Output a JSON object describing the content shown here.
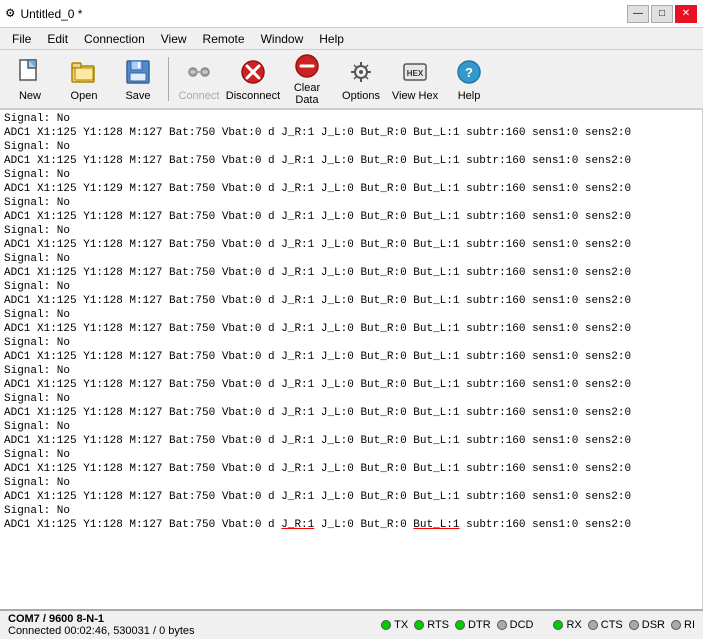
{
  "titlebar": {
    "icon": "⚙",
    "title": "Untitled_0 *",
    "minimize": "—",
    "maximize": "□",
    "close": "✕"
  },
  "menubar": {
    "items": [
      "File",
      "Edit",
      "Connection",
      "View",
      "Remote",
      "Window",
      "Help"
    ]
  },
  "toolbar": {
    "buttons": [
      {
        "id": "new",
        "label": "New",
        "icon": "new",
        "disabled": false
      },
      {
        "id": "open",
        "label": "Open",
        "icon": "open",
        "disabled": false
      },
      {
        "id": "save",
        "label": "Save",
        "icon": "save",
        "disabled": false
      },
      {
        "id": "connect",
        "label": "Connect",
        "icon": "connect",
        "disabled": true
      },
      {
        "id": "disconnect",
        "label": "Disconnect",
        "icon": "disconnect",
        "disabled": false
      },
      {
        "id": "clear",
        "label": "Clear Data",
        "icon": "clear",
        "disabled": false
      },
      {
        "id": "options",
        "label": "Options",
        "icon": "options",
        "disabled": false
      },
      {
        "id": "viewhex",
        "label": "View Hex",
        "icon": "viewhex",
        "disabled": false
      },
      {
        "id": "help",
        "label": "Help",
        "icon": "help",
        "disabled": false
      }
    ]
  },
  "log": {
    "lines": [
      "Signal: No",
      "ADC1 X1:125 Y1:128  M:127 Bat:750 Vbat:0 d J_R:1 J_L:0 But_R:0 But_L:1 subtr:160 sens1:0 sens2:0",
      "Signal: No",
      "ADC1 X1:125 Y1:128  M:127 Bat:750 Vbat:0 d J_R:1 J_L:0 But_R:0 But_L:1 subtr:160 sens1:0 sens2:0",
      "Signal: No",
      "ADC1 X1:125 Y1:129  M:127 Bat:750 Vbat:0 d J_R:1 J_L:0 But_R:0 But_L:1 subtr:160 sens1:0 sens2:0",
      "Signal: No",
      "ADC1 X1:125 Y1:128  M:127 Bat:750 Vbat:0 d J_R:1 J_L:0 But_R:0 But_L:1 subtr:160 sens1:0 sens2:0",
      "Signal: No",
      "ADC1 X1:125 Y1:128  M:127 Bat:750 Vbat:0 d J_R:1 J_L:0 But_R:0 But_L:1 subtr:160 sens1:0 sens2:0",
      "Signal: No",
      "ADC1 X1:125 Y1:128  M:127 Bat:750 Vbat:0 d J_R:1 J_L:0 But_R:0 But_L:1 subtr:160 sens1:0 sens2:0",
      "Signal: No",
      "ADC1 X1:125 Y1:128  M:127 Bat:750 Vbat:0 d J_R:1 J_L:0 But_R:0 But_L:1 subtr:160 sens1:0 sens2:0",
      "Signal: No",
      "ADC1 X1:125 Y1:128  M:127 Bat:750 Vbat:0 d J_R:1 J_L:0 But_R:0 But_L:1 subtr:160 sens1:0 sens2:0",
      "Signal: No",
      "ADC1 X1:125 Y1:128  M:127 Bat:750 Vbat:0 d J_R:1 J_L:0 But_R:0 But_L:1 subtr:160 sens1:0 sens2:0",
      "Signal: No",
      "ADC1 X1:125 Y1:128  M:127 Bat:750 Vbat:0 d J_R:1 J_L:0 But_R:0 But_L:1 subtr:160 sens1:0 sens2:0",
      "Signal: No",
      "ADC1 X1:125 Y1:128  M:127 Bat:750 Vbat:0 d J_R:1 J_L:0 But_R:0 But_L:1 subtr:160 sens1:0 sens2:0",
      "Signal: No",
      "ADC1 X1:125 Y1:128  M:127 Bat:750 Vbat:0 d J_R:1 J_L:0 But_R:0 But_L:1 subtr:160 sens1:0 sens2:0",
      "Signal: No",
      "ADC1 X1:125 Y1:128  M:127 Bat:750 Vbat:0 d J_R:1 J_L:0 But_R:0 But_L:1 subtr:160 sens1:0 sens2:0",
      "Signal: No",
      "ADC1 X1:125 Y1:128  M:127 Bat:750 Vbat:0 d J_R:1 J_L:0 But_R:0 But_L:1 subtr:160 sens1:0 sens2:0"
    ],
    "last_signal": "Signal: No",
    "last_adc": "ADC1 X1:125 Y1:128  M:127 Bat:750 Vbat:0 d J_R:1 J_L:0 But_R:0 But_L:1 subtr:160 sens1:0 sens2:0"
  },
  "statusbar": {
    "port_info": "COM7 / 9600 8-N-1",
    "connection_info": "Connected 00:02:46, 530031 / 0 bytes",
    "indicators": [
      {
        "label": "TX",
        "active": true
      },
      {
        "label": "RX",
        "active": true
      },
      {
        "label": "RTS",
        "active": true
      },
      {
        "label": "CTS",
        "active": false
      },
      {
        "label": "DTR",
        "active": true
      },
      {
        "label": "DSR",
        "active": false
      },
      {
        "label": "DCD",
        "active": false
      },
      {
        "label": "RI",
        "active": false
      }
    ]
  }
}
